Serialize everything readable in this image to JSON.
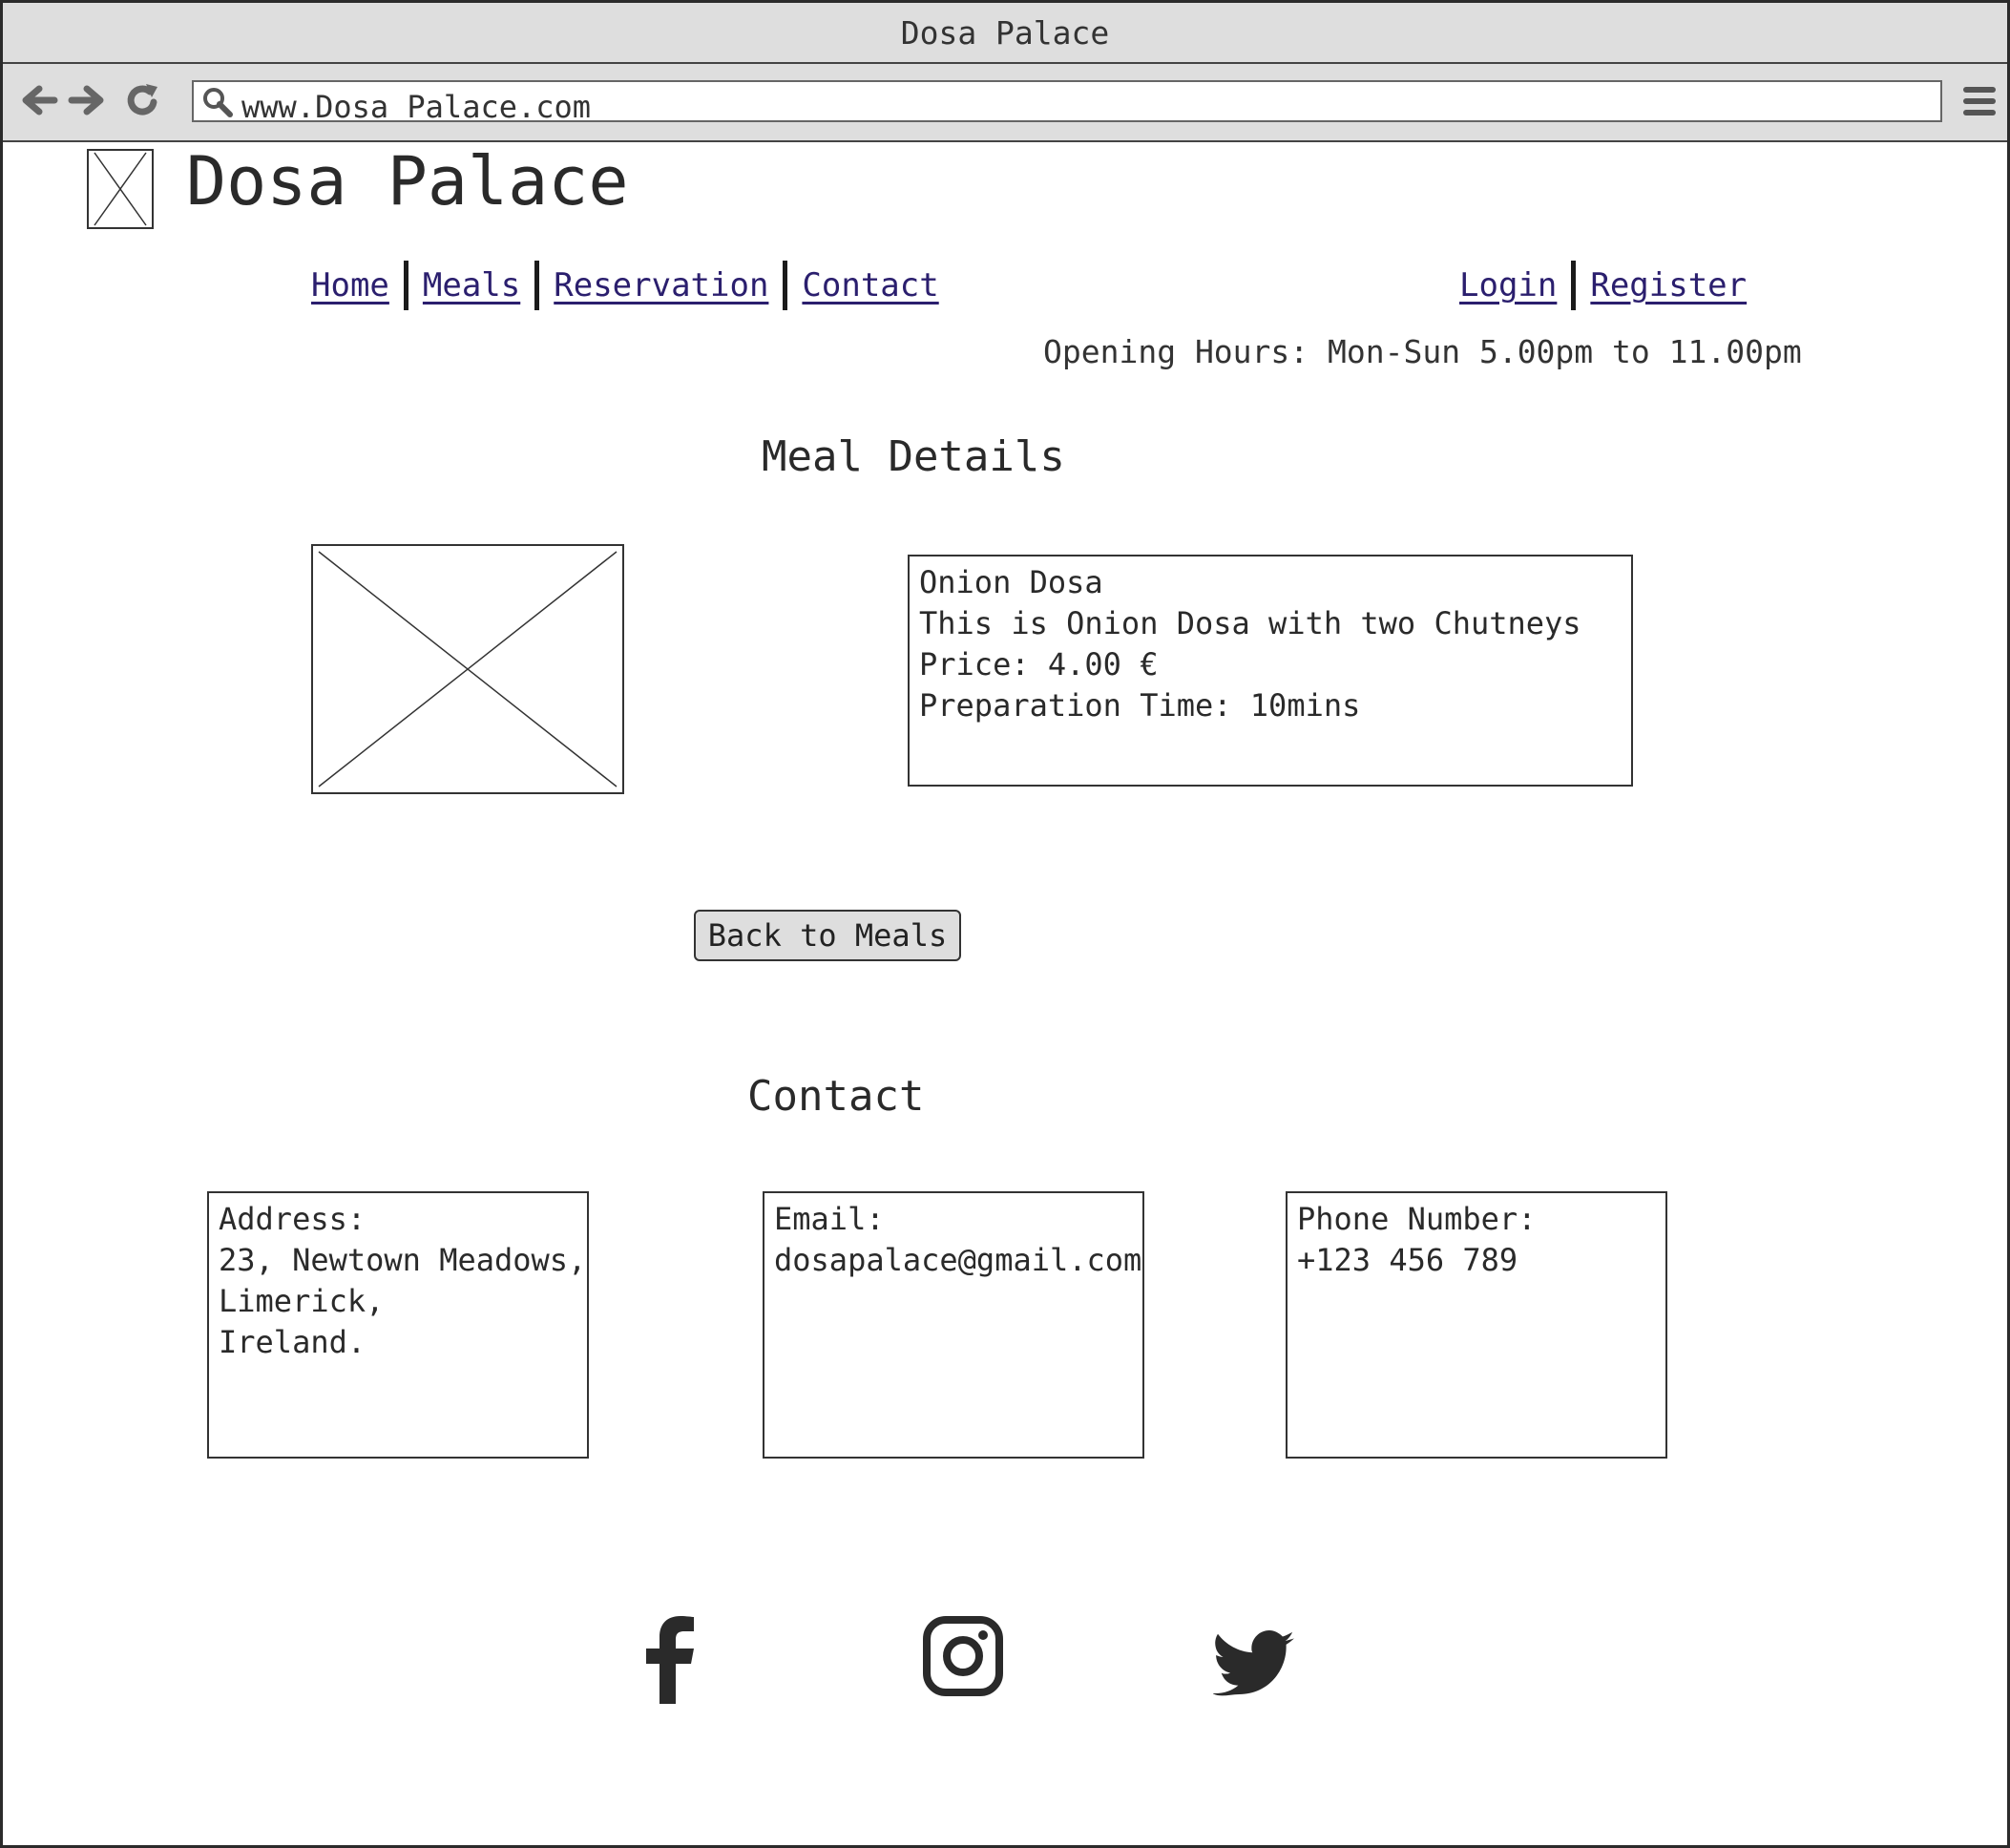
{
  "browser": {
    "title": "Dosa Palace",
    "url": "www.Dosa Palace.com"
  },
  "site": {
    "brand": "Dosa Palace"
  },
  "nav": {
    "links": [
      "Home",
      "Meals",
      "Reservation",
      "Contact"
    ],
    "account": [
      "Login",
      "Register"
    ]
  },
  "hours": "Opening Hours: Mon-Sun 5.00pm to 11.00pm",
  "meal_section": {
    "heading": "Meal Details",
    "name": "Onion Dosa",
    "description": "This is Onion Dosa with two Chutneys",
    "price": "Price: 4.00 €",
    "prep_time": "Preparation Time: 10mins",
    "back_button": "Back to Meals"
  },
  "contact": {
    "heading": "Contact",
    "address_label": "Address:",
    "address_lines": [
      "23, Newtown Meadows,",
      "Limerick,",
      "Ireland."
    ],
    "email_label": "Email:",
    "email": "dosapalace@gmail.com",
    "phone_label": "Phone Number:",
    "phone": "+123 456 789"
  },
  "social_icons": [
    "facebook-icon",
    "instagram-icon",
    "twitter-icon"
  ]
}
